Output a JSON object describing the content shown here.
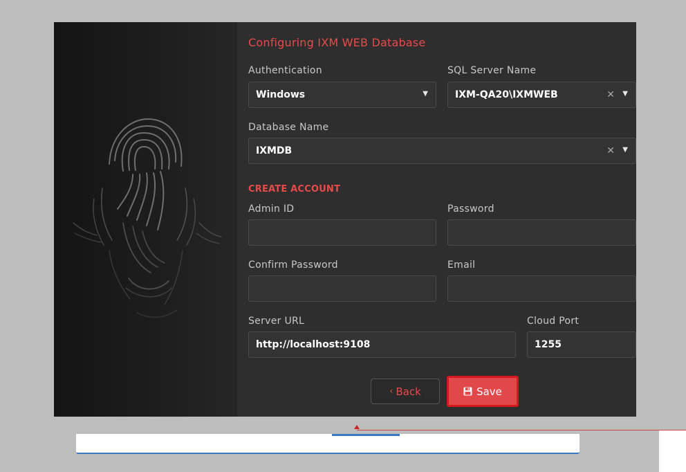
{
  "dialog": {
    "title": "Configuring IXM WEB Database",
    "authentication": {
      "label": "Authentication",
      "value": "Windows"
    },
    "sql_server": {
      "label": "SQL Server Name",
      "value": "IXM-QA20\\IXMWEB",
      "clear": "✕"
    },
    "database": {
      "label": "Database Name",
      "value": "IXMDB",
      "clear": "✕"
    },
    "section_title": "CREATE ACCOUNT",
    "admin_id": {
      "label": "Admin ID",
      "value": ""
    },
    "password": {
      "label": "Password",
      "value": ""
    },
    "confirm_password": {
      "label": "Confirm Password",
      "value": ""
    },
    "email": {
      "label": "Email",
      "value": ""
    },
    "server_url": {
      "label": "Server URL",
      "value": "http://localhost:9108"
    },
    "cloud_port": {
      "label": "Cloud Port",
      "value": "1255"
    },
    "back_button": {
      "label": "Back",
      "icon": "chevron-left-icon"
    },
    "save_button": {
      "label": "Save",
      "icon": "floppy-disk-icon"
    }
  },
  "colors": {
    "accent": "#e84a4a",
    "dialog_bg": "#2e2e2e",
    "field_bg": "#333333",
    "highlight_border": "#d6181c"
  }
}
